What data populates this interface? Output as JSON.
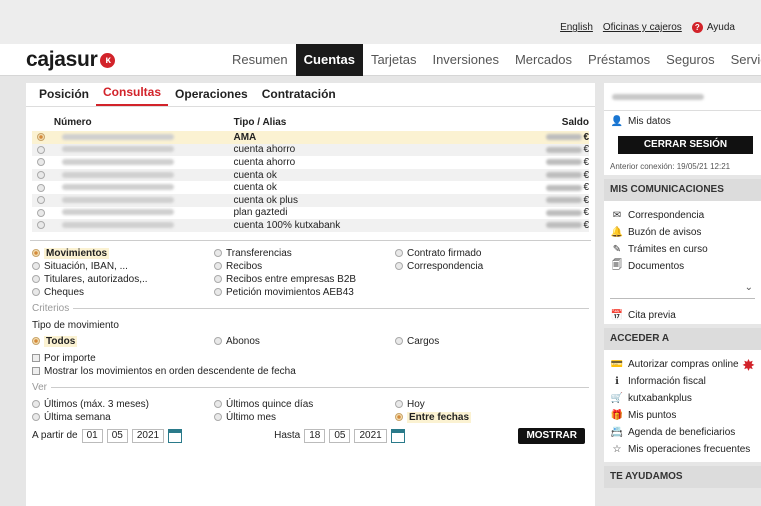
{
  "topbar": {
    "links": [
      "English",
      "Oficinas y cajeros"
    ],
    "help": "Ayuda"
  },
  "brand": {
    "name": "cajasur"
  },
  "nav": {
    "items": [
      "Resumen",
      "Cuentas",
      "Tarjetas",
      "Inversiones",
      "Mercados",
      "Préstamos",
      "Seguros",
      "Servicios"
    ],
    "active": "Cuentas"
  },
  "subtabs": {
    "items": [
      "Posición",
      "Consultas",
      "Operaciones",
      "Contratación"
    ],
    "active": "Consultas"
  },
  "accounts": {
    "headers": {
      "numero": "Número",
      "tipo": "Tipo / Alias",
      "saldo": "Saldo"
    },
    "currency": "€",
    "rows": [
      {
        "tipo": "AMA",
        "selected": true
      },
      {
        "tipo": "cuenta ahorro",
        "selected": false
      },
      {
        "tipo": "cuenta ahorro",
        "selected": false
      },
      {
        "tipo": "cuenta ok",
        "selected": false
      },
      {
        "tipo": "cuenta ok",
        "selected": false
      },
      {
        "tipo": "cuenta ok plus",
        "selected": false
      },
      {
        "tipo": "plan gaztedi",
        "selected": false
      },
      {
        "tipo": "cuenta 100% kutxabank",
        "selected": false
      }
    ]
  },
  "consult_options": {
    "col1": [
      "Movimientos",
      "Situación, IBAN, ...",
      "Titulares, autorizados,..",
      "Cheques"
    ],
    "col2": [
      "Transferencias",
      "Recibos",
      "Recibos entre empresas B2B",
      "Petición movimientos AEB43"
    ],
    "col3": [
      "Contrato firmado",
      "Correspondencia"
    ],
    "selected": "Movimientos"
  },
  "criterios": {
    "title": "Criterios",
    "tipo_label": "Tipo de movimiento",
    "tipo_options": [
      "Todos",
      "Abonos",
      "Cargos"
    ],
    "tipo_selected": "Todos",
    "checks": [
      "Por importe",
      "Mostrar los movimientos en orden descendente de fecha"
    ]
  },
  "ver": {
    "title": "Ver",
    "row1": [
      "Últimos (máx. 3 meses)",
      "Últimos quince días",
      "Hoy"
    ],
    "row2": [
      "Última semana",
      "Último mes",
      "Entre fechas"
    ],
    "selected": "Entre fechas",
    "from_label": "A partir de",
    "from": [
      "01",
      "05",
      "2021"
    ],
    "to_label": "Hasta",
    "to": [
      "18",
      "05",
      "2021"
    ],
    "button": "MOSTRAR"
  },
  "sidebar": {
    "mis_datos": "Mis datos",
    "logout": "CERRAR SESIÓN",
    "last_conn": "Anterior conexión: 19/05/21 12:21",
    "comunicaciones": {
      "title": "MIS COMUNICACIONES",
      "items": [
        "Correspondencia",
        "Buzón de avisos",
        "Trámites en curso",
        "Documentos"
      ],
      "cita": "Cita previa"
    },
    "acceder": {
      "title": "ACCEDER A",
      "items": [
        "Autorizar compras online",
        "Información fiscal",
        "kutxabankplus",
        "Mis puntos",
        "Agenda de beneficiarios",
        "Mis operaciones frecuentes"
      ]
    },
    "ayudamos": {
      "title": "TE AYUDAMOS"
    }
  },
  "colors": {
    "brand": "#d2232a",
    "dark": "#1a1a1a",
    "highlight": "#fbf2d2"
  }
}
